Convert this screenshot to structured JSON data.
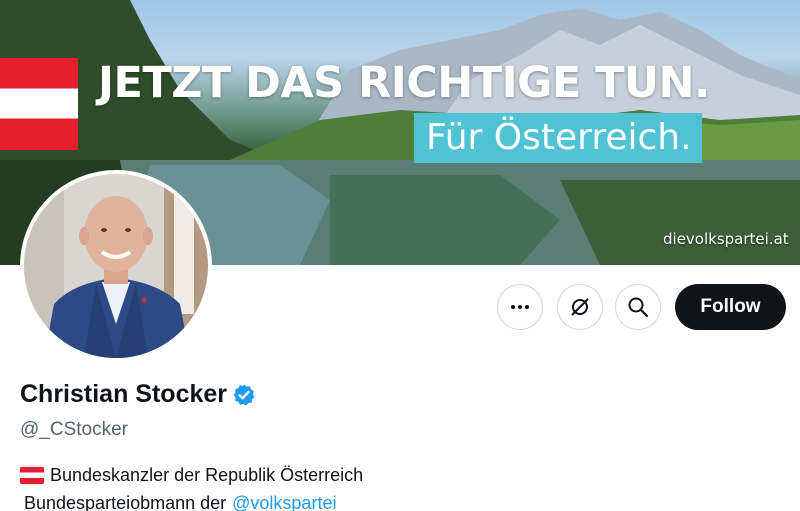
{
  "banner": {
    "headline": "JETZT DAS RICHTIGE TUN.",
    "subline": "Für Österreich.",
    "site": "dievolkspartei.at"
  },
  "profile": {
    "name": "Christian Stocker",
    "handle": "@_CStocker",
    "bio_line1": "Bundeskanzler der Republik Österreich",
    "bio_line2": "Bundesparteiobmann der",
    "bio_mention": "@volkspartei"
  },
  "actions": {
    "more_icon": "more-icon",
    "notify_icon": "notifications-off-icon",
    "search_icon": "search-icon",
    "follow_label": "Follow"
  },
  "colors": {
    "follow_bg": "#0f1419",
    "verified": "#1d9bf0",
    "mention": "#1d9bf0",
    "subline_bg": "#4fc3d4",
    "flag_red": "#e4202c"
  }
}
